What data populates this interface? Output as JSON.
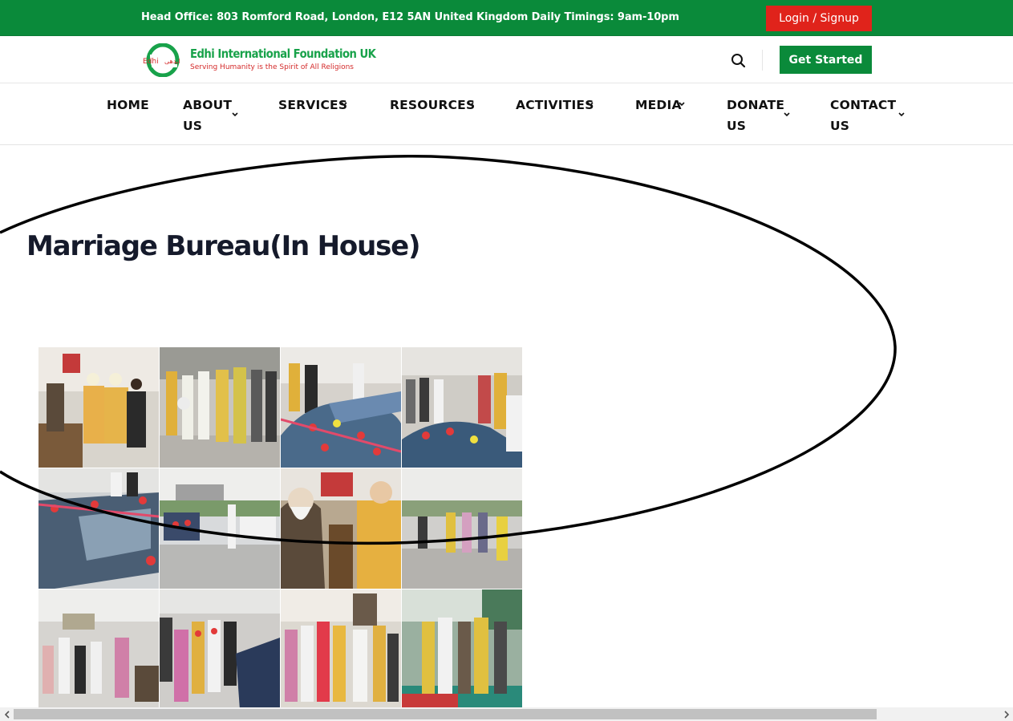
{
  "topbar": {
    "info_text": "Head Office: 803 Romford Road, London, E12 5AN United Kingdom Daily Timings: 9am-10pm",
    "login_label": "Login / Signup"
  },
  "header": {
    "logo_title": "Edhi International Foundation UK",
    "logo_tagline": "Serving Humanity is the Spirit of All Religions",
    "logo_mark_text": "Edhi",
    "get_started_label": "Get Started"
  },
  "nav": {
    "items": [
      {
        "line1": "HOME",
        "line2": "",
        "dropdown": false
      },
      {
        "line1": "ABOUT",
        "line2": "US",
        "dropdown": true
      },
      {
        "line1": "SERVICES",
        "line2": "",
        "dropdown": true
      },
      {
        "line1": "RESOURCES",
        "line2": "",
        "dropdown": true
      },
      {
        "line1": "ACTIVITIES",
        "line2": "",
        "dropdown": true
      },
      {
        "line1": "MEDIA",
        "line2": "",
        "dropdown": true
      },
      {
        "line1": "DONATE",
        "line2": "US",
        "dropdown": true
      },
      {
        "line1": "CONTACT",
        "line2": "US",
        "dropdown": true
      }
    ]
  },
  "page": {
    "title": "Marriage Bureau(In House)"
  },
  "gallery": {
    "photos": [
      {
        "scene": "grooms seated indoors"
      },
      {
        "scene": "wedding procession street"
      },
      {
        "scene": "decorated car with flowers"
      },
      {
        "scene": "crowd around decorated car"
      },
      {
        "scene": "decorated car side view"
      },
      {
        "scene": "street with cars"
      },
      {
        "scene": "elder seated with groom"
      },
      {
        "scene": "street gathering"
      },
      {
        "scene": "crowd in street"
      },
      {
        "scene": "procession near car"
      },
      {
        "scene": "celebration indoors"
      },
      {
        "scene": "grooms walking on carpet"
      }
    ]
  },
  "colors": {
    "brand_green": "#0a8a3a",
    "login_red": "#e0231b",
    "title_navy": "#151a2b"
  }
}
